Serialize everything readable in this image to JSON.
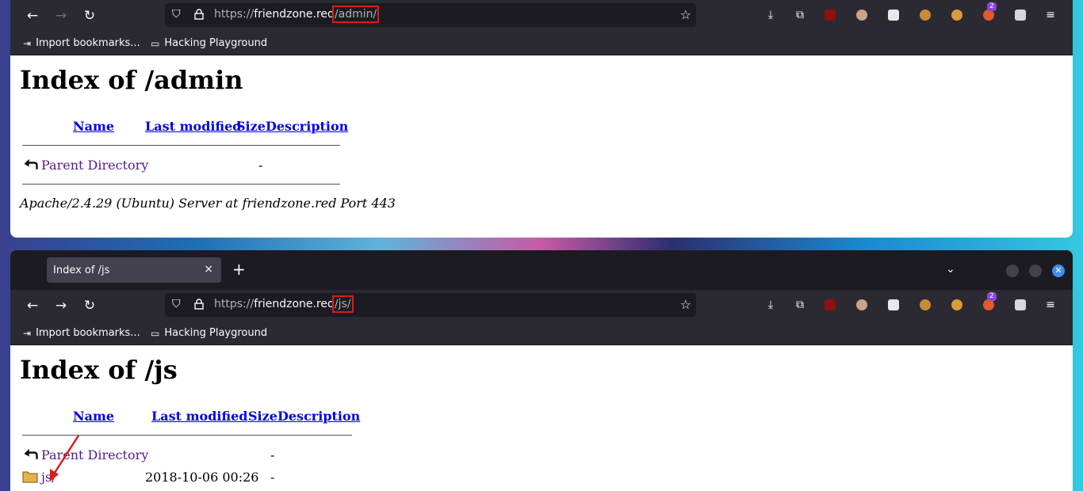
{
  "window_top": {
    "url": {
      "prefix": "https://",
      "host": "friendzone.red",
      "path": "/admin/"
    },
    "bookmarks": [
      {
        "label": "Import bookmarks..."
      },
      {
        "label": "Hacking Playground"
      }
    ],
    "extension_badge": "2",
    "page": {
      "title": "Index of /admin",
      "columns": {
        "name": "Name",
        "last_modified": "Last modified",
        "size": "Size",
        "description": "Description"
      },
      "rows": [
        {
          "name": "Parent Directory",
          "last_modified": "",
          "size": "-",
          "icon": "back-arrow-icon"
        }
      ],
      "footer": "Apache/2.4.29 (Ubuntu) Server at friendzone.red Port 443"
    }
  },
  "window_bottom": {
    "tab": {
      "title": "Index of /js",
      "close": "×"
    },
    "url": {
      "prefix": "https://",
      "host": "friendzone.red",
      "path": "/js/"
    },
    "bookmarks": [
      {
        "label": "Import bookmarks..."
      },
      {
        "label": "Hacking Playground"
      }
    ],
    "extension_badge": "2",
    "page": {
      "title": "Index of /js",
      "columns": {
        "name": "Name",
        "last_modified": "Last modified",
        "size": "Size",
        "description": "Description"
      },
      "rows": [
        {
          "name": "Parent Directory",
          "last_modified": "",
          "size": "-",
          "icon": "back-arrow-icon"
        },
        {
          "name": "js/",
          "last_modified": "2018-10-06 00:26",
          "size": "-",
          "icon": "folder-icon"
        }
      ]
    }
  },
  "colors": {
    "annotation_red": "#e01919",
    "link": "#0000ee",
    "visited_link": "#551a8b",
    "accent_blue": "#3f8df0"
  }
}
